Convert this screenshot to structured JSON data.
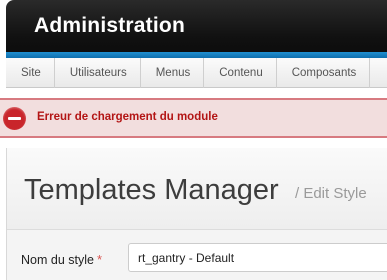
{
  "header": {
    "title": "Administration"
  },
  "menu": {
    "items": [
      {
        "label": "Site"
      },
      {
        "label": "Utilisateurs"
      },
      {
        "label": "Menus"
      },
      {
        "label": "Contenu"
      },
      {
        "label": "Composants"
      }
    ]
  },
  "alert": {
    "icon": "error-minus-icon",
    "message": "Erreur de chargement du module",
    "color": "#b31515"
  },
  "page": {
    "title": "Templates Manager",
    "subtitle": "/ Edit Style"
  },
  "form": {
    "style_name_label": "Nom du style",
    "required_marker": "*",
    "style_name_value": "rt_gantry - Default"
  },
  "colors": {
    "accent": "#1a82c4",
    "header_bg": "#111111",
    "alert_bg": "#f2dede"
  }
}
